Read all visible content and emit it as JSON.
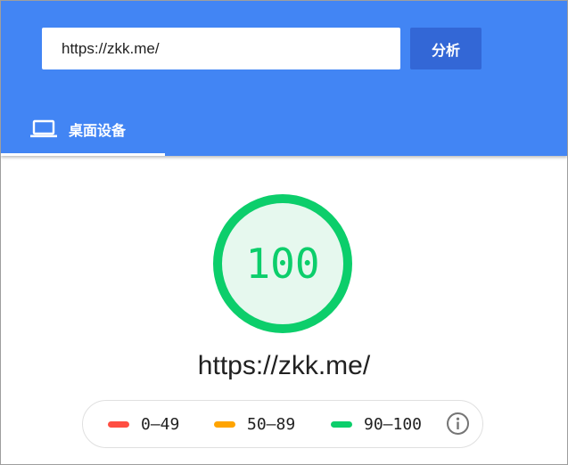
{
  "search": {
    "url_value": "https://zkk.me/",
    "analyze_label": "分析"
  },
  "tabs": [
    {
      "label": "桌面设备",
      "icon": "laptop-icon",
      "selected": true
    }
  ],
  "report": {
    "score": "100",
    "url": "https://zkk.me/"
  },
  "legend": {
    "items": [
      {
        "label": "0–49",
        "color": "#ff4e42"
      },
      {
        "label": "50–89",
        "color": "#ffa400"
      },
      {
        "label": "90–100",
        "color": "#0cce6b"
      }
    ],
    "info_icon": "info-icon"
  },
  "colors": {
    "header_bg": "#4285f4",
    "button_bg": "#3367d6",
    "pass": "#0cce6b",
    "pass_fill": "#e6f8ee"
  }
}
